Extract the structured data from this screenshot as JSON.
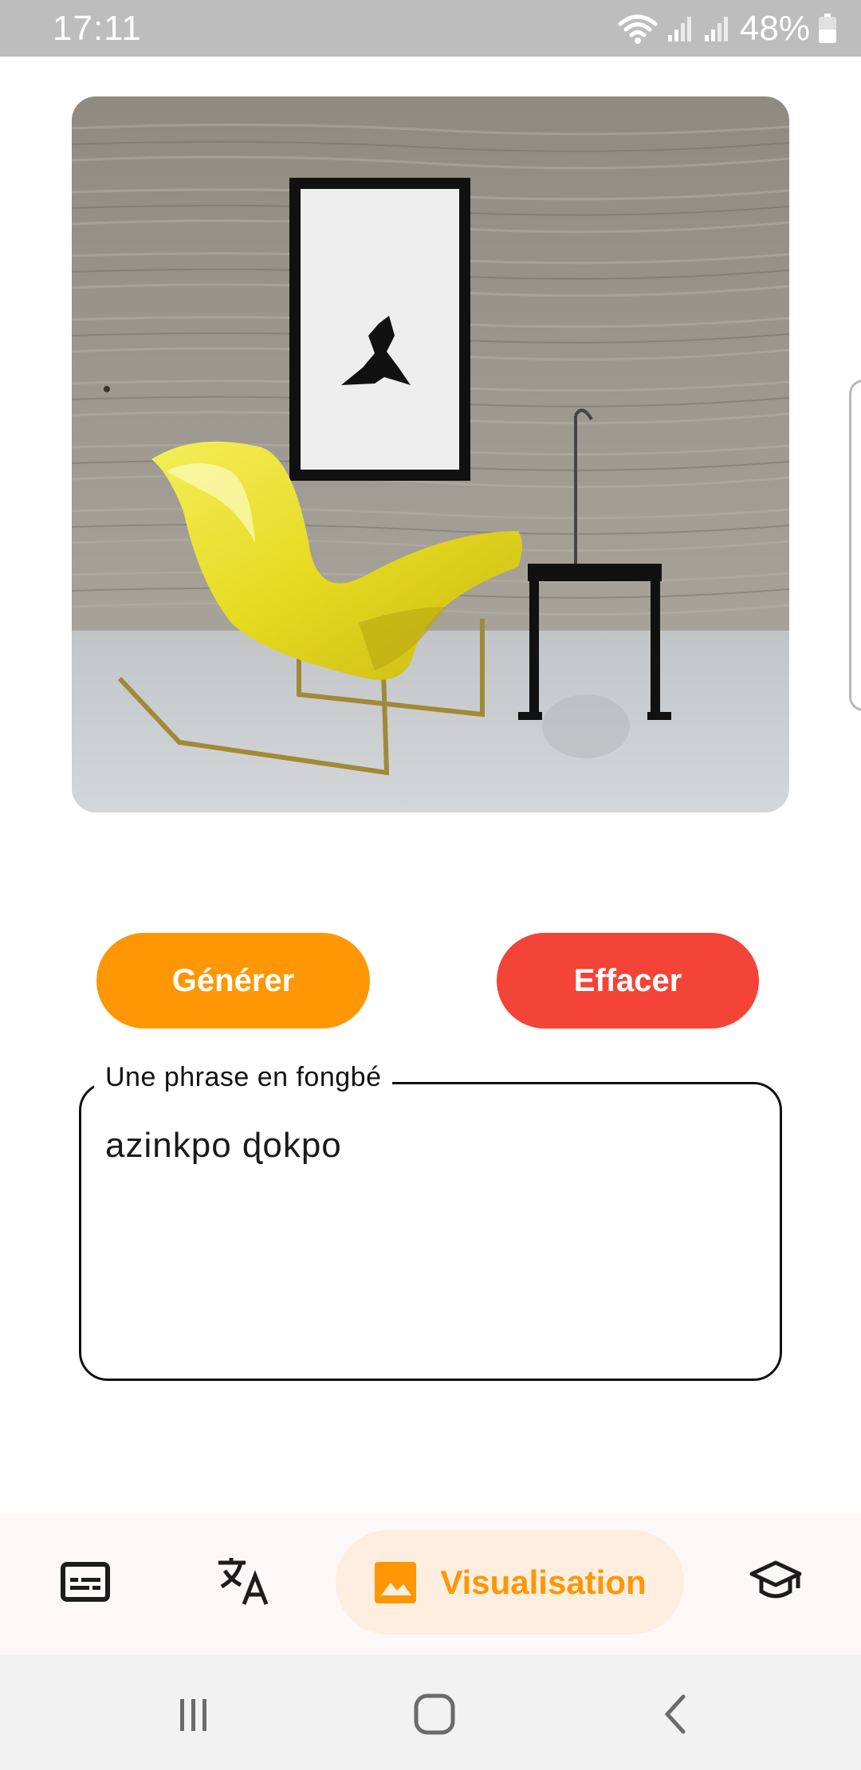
{
  "status_bar": {
    "time": "17:11",
    "battery": "48%",
    "icons": [
      "wifi-icon",
      "signal-icon",
      "signal-icon",
      "battery-icon"
    ]
  },
  "generated_image": {
    "icon": "generated-image"
  },
  "actions": {
    "generate_label": "Générer",
    "clear_label": "Effacer"
  },
  "input": {
    "label": "Une phrase en fongbé",
    "value": "azinkpo ɖokpo"
  },
  "bottom_nav": {
    "items": [
      {
        "icon": "subtitles-icon",
        "active": false
      },
      {
        "icon": "translate-icon",
        "active": false
      },
      {
        "icon": "image-icon",
        "label": "Visualisation",
        "active": true
      },
      {
        "icon": "school-icon",
        "active": false
      }
    ]
  },
  "colors": {
    "accent": "#fe9703",
    "danger": "#f44337",
    "active_nav_bg": "#fdeee0",
    "status_bar": "#bdbdbd"
  },
  "system_nav": {
    "icons": [
      "recent-apps-icon",
      "home-icon",
      "back-icon"
    ]
  }
}
